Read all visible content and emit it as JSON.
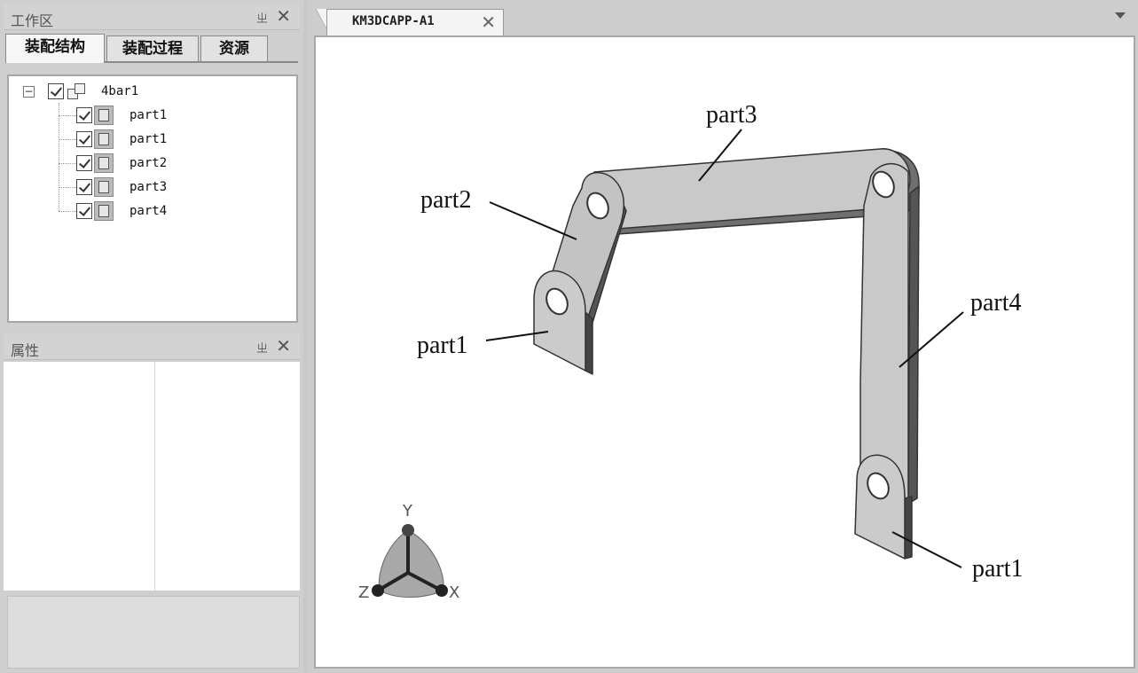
{
  "workspace": {
    "title": "工作区",
    "pin": "ㄓ",
    "close": "✕",
    "tabs": [
      {
        "label": "装配结构",
        "active": true
      },
      {
        "label": "装配过程",
        "active": false
      },
      {
        "label": "资源",
        "active": false
      }
    ],
    "tree": {
      "root": {
        "label": "4bar1",
        "expander": "−",
        "checked": true
      },
      "children": [
        {
          "label": "part1",
          "checked": true
        },
        {
          "label": "part1",
          "checked": true
        },
        {
          "label": "part2",
          "checked": true
        },
        {
          "label": "part3",
          "checked": true
        },
        {
          "label": "part4",
          "checked": true
        }
      ]
    }
  },
  "properties": {
    "title": "属性",
    "pin": "ㄓ",
    "close": "✕"
  },
  "document": {
    "tab_label": "KM3DCAPP-A1",
    "tab_close": "✕"
  },
  "viewport": {
    "labels": {
      "part3": "part3",
      "part2": "part2",
      "part1_left": "part1",
      "part4": "part4",
      "part1_right": "part1"
    },
    "triad": {
      "y": "Y",
      "z": "Z",
      "x": "X"
    },
    "colors": {
      "part_face": "#c8c8c8",
      "part_edge": "#333333"
    }
  }
}
